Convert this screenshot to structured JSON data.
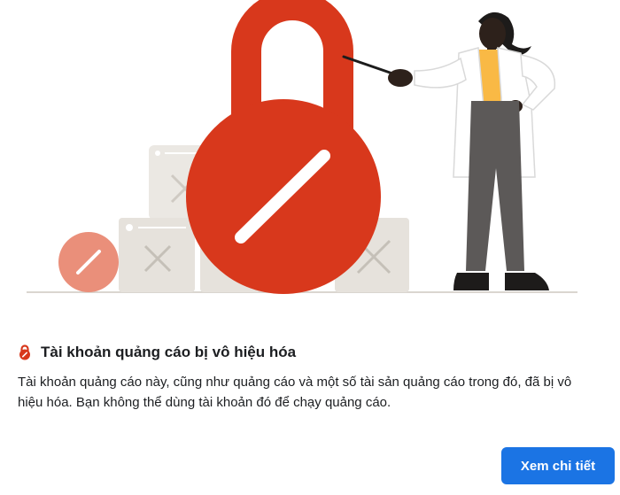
{
  "notice": {
    "title": "Tài khoản quảng cáo bị vô hiệu hóa",
    "description": "Tài khoản quảng cáo này, cũng như quảng cáo và một số tài sản quảng cáo trong đó, đã bị vô hiệu hóa. Bạn không thể dùng tài khoản đó để chạy quảng cáo.",
    "icon": "lock-icon"
  },
  "actions": {
    "detail_label": "Xem chi tiết"
  },
  "colors": {
    "lock_red": "#d8381c",
    "small_badge": "#ea8f7a",
    "button_blue": "#1b74e4",
    "box_beige": "#e6e2dc",
    "shirt_yellow": "#f9b945",
    "pants_gray": "#5c5958"
  }
}
